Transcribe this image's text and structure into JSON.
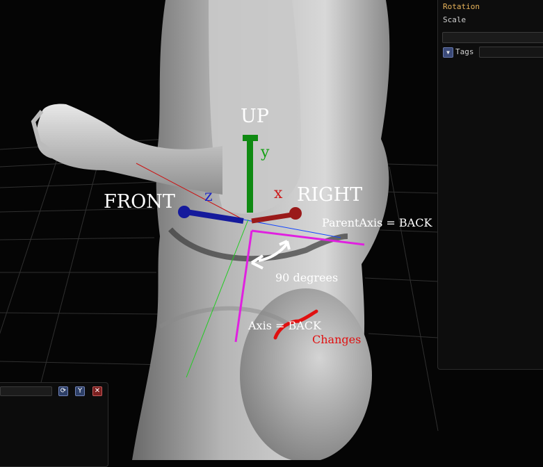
{
  "viewport": {
    "labels": {
      "up": "UP",
      "front": "FRONT",
      "right": "RIGHT",
      "y_axis": "y",
      "z_axis": "z",
      "x_axis": "x",
      "parent_axis": "ParentAxis = BACK",
      "angle": "90 degrees",
      "axis": "Axis = BACK",
      "changes": "Changes"
    },
    "colors": {
      "background": "#050505",
      "grid": "#3a3a3a",
      "figure": "#9a9a9a",
      "y_axis": "#0f8a12",
      "z_axis": "#151a9c",
      "x_axis": "#9a1a1a",
      "annotation_magenta": "#e020e0",
      "changes_red": "#e01010"
    }
  },
  "properties_panel": {
    "rotation_label": "Rotation",
    "scale_label": "Scale",
    "tags_label": "Tags",
    "tags_toggle_icon": "triangle-down-icon"
  },
  "bottom_panel": {
    "buttons": {
      "refresh_icon": "refresh-icon",
      "filter_icon": "filter-icon",
      "close_icon": "close-icon"
    }
  }
}
